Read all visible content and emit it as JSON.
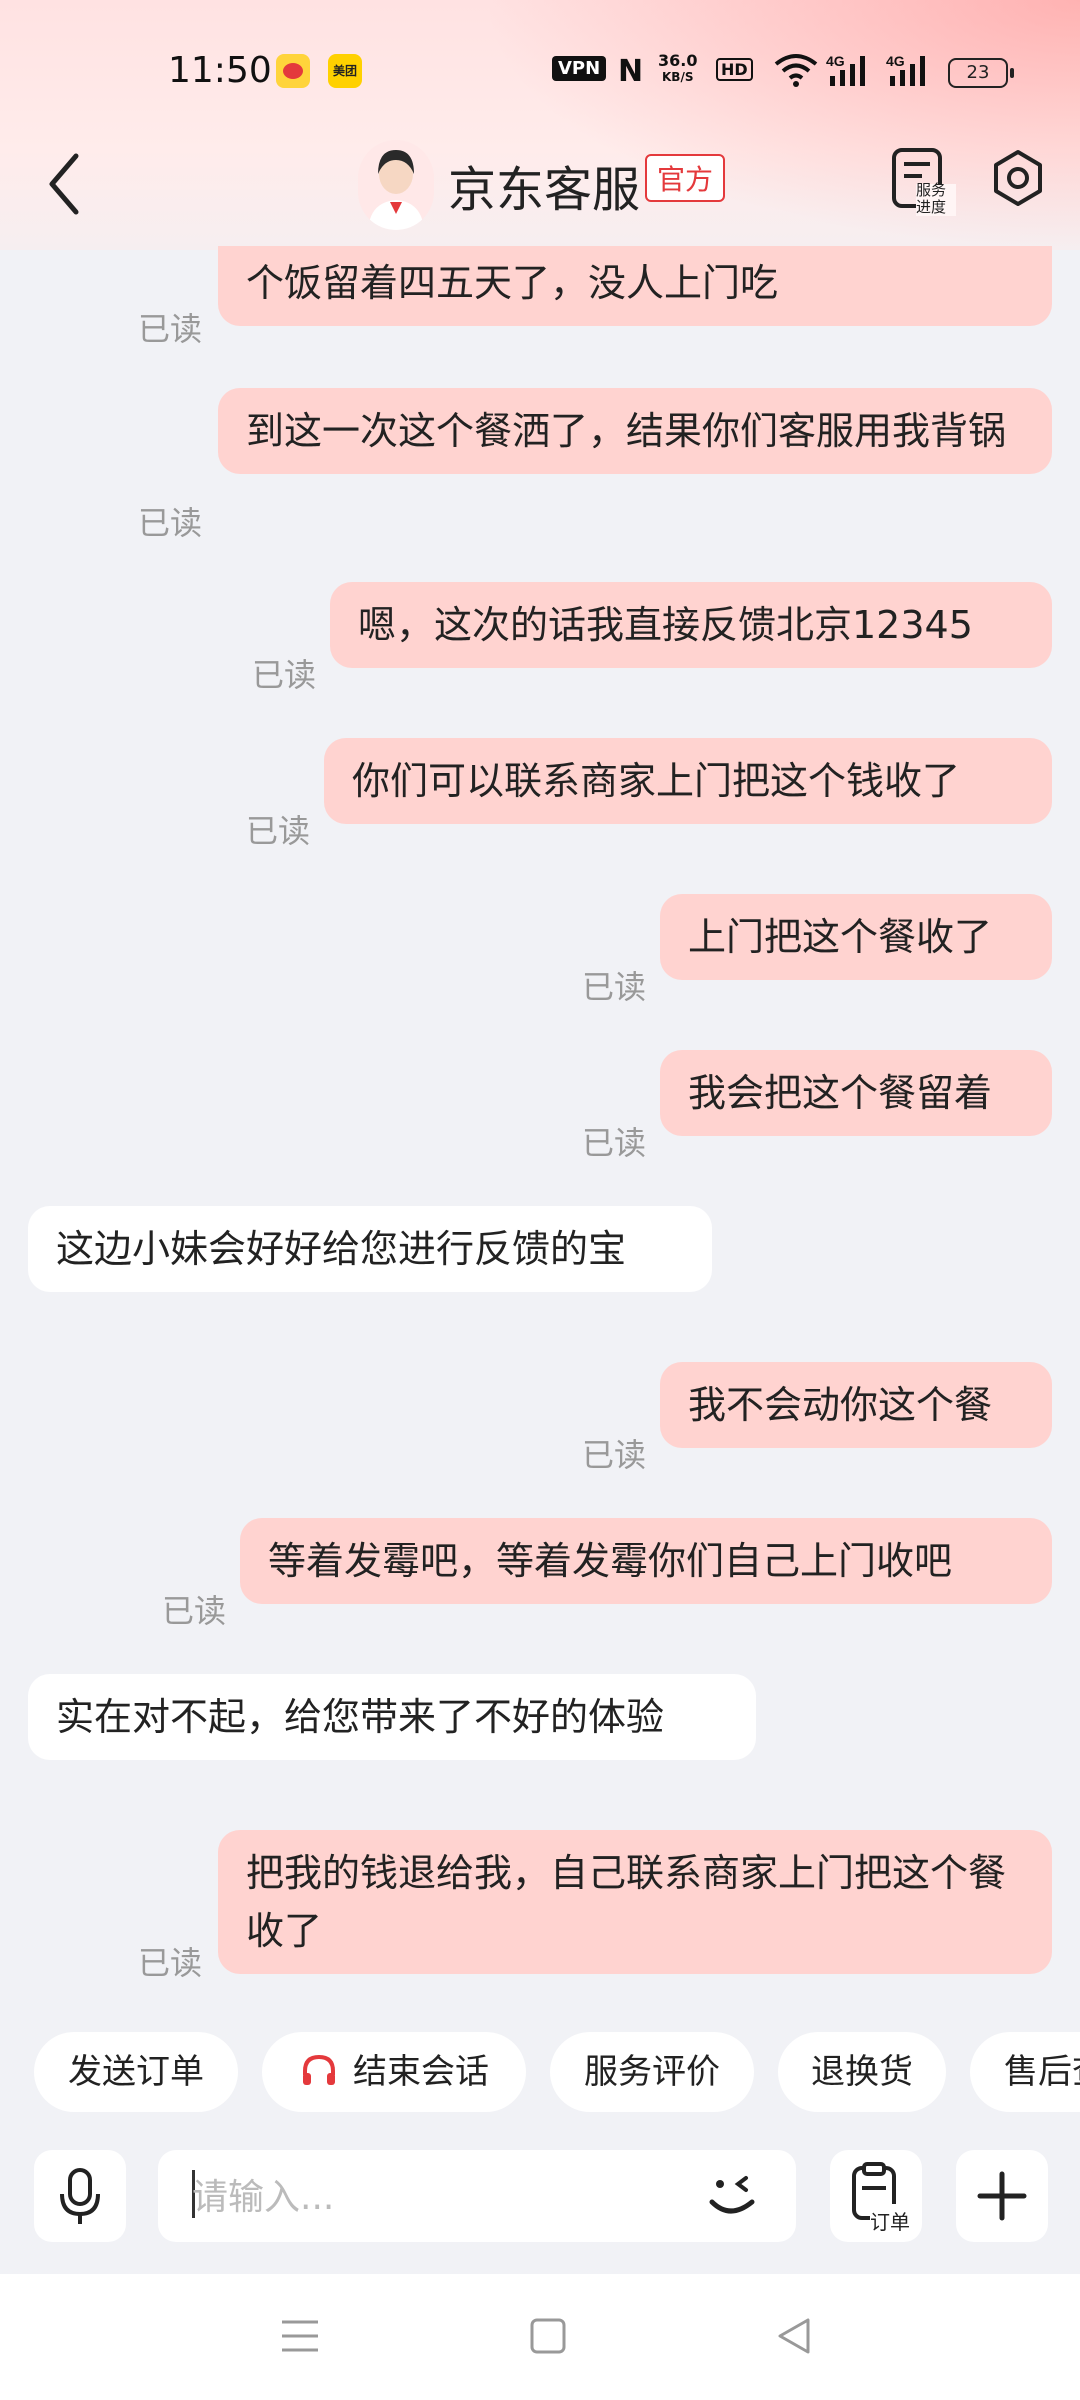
{
  "status_bar": {
    "time": "11:50",
    "meituan_label": "美团",
    "vpn": "VPN",
    "nfc": "N",
    "speed": "36.0",
    "speed_unit": "KB/S",
    "hd": "HD",
    "net1": "4G",
    "net2": "4G",
    "battery": "23"
  },
  "header": {
    "title": "京东客服",
    "badge": "官方",
    "service_progress": "服务进度"
  },
  "chat": {
    "messages": [
      {
        "side": "out",
        "text": "们不赔偿也可以，你们把那个饭吃了，结果那个饭留着四五天了，没人上门吃",
        "status": "已读"
      },
      {
        "side": "out",
        "text": "到这一次这个餐洒了，结果你们客服用我背锅",
        "status": "已读"
      },
      {
        "side": "out",
        "text": "嗯，这次的话我直接反馈北京12345",
        "status": "已读"
      },
      {
        "side": "out",
        "text": "你们可以联系商家上门把这个钱收了",
        "status": "已读"
      },
      {
        "side": "out",
        "text": "上门把这个餐收了",
        "status": "已读"
      },
      {
        "side": "out",
        "text": "我会把这个餐留着",
        "status": "已读"
      },
      {
        "side": "in",
        "text": "这边小妹会好好给您进行反馈的宝"
      },
      {
        "side": "out",
        "text": "我不会动你这个餐",
        "status": "已读"
      },
      {
        "side": "out",
        "text": "等着发霉吧，等着发霉你们自己上门收吧",
        "status": "已读"
      },
      {
        "side": "in",
        "text": "实在对不起，给您带来了不好的体验"
      },
      {
        "side": "out",
        "text": "把我的钱退给我，自己联系商家上门把这个餐收了",
        "status": "已读"
      }
    ]
  },
  "quick_actions": [
    "发送订单",
    "结束会话",
    "服务评价",
    "退换货",
    "售后查"
  ],
  "input": {
    "placeholder": "请输入...",
    "order_label": "订单"
  },
  "colors": {
    "accent": "#e4393c",
    "outgoing_bubble": "#ffd3d0",
    "incoming_bubble": "#ffffff",
    "background": "#f1f2f6"
  },
  "icons": {
    "back": "chevron-left-icon",
    "settings": "settings-icon",
    "mic": "microphone-icon",
    "emoji": "wink-emoji-icon",
    "plus": "plus-icon",
    "headset": "headset-icon"
  }
}
